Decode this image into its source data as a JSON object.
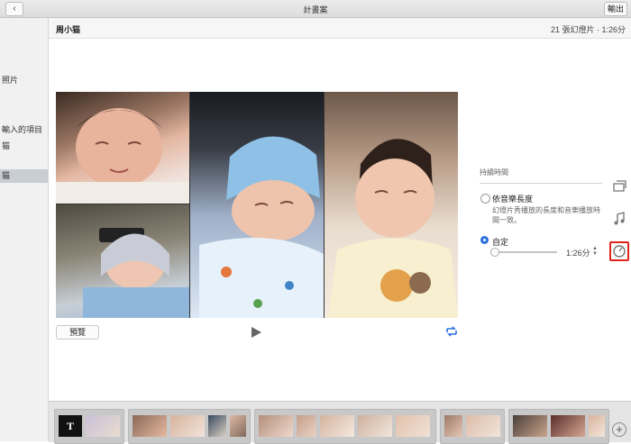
{
  "window": {
    "title": "計畫案",
    "back_glyph": "‹",
    "export_label": "輸出"
  },
  "sidebar": {
    "items": [
      "照片",
      "輸入的項目",
      "猫",
      "猫"
    ]
  },
  "project": {
    "name": "周小猫",
    "info": "21 張幻燈片 · 1:26分"
  },
  "player": {
    "preview_label": "預覽"
  },
  "settings": {
    "heading": "持續時間",
    "options": [
      {
        "label": "依音樂長度",
        "desc_line1": "幻燈片秀播放的長度和音樂播放時",
        "desc_line2": "間一致。",
        "selected": false
      },
      {
        "label": "自定",
        "selected": true
      }
    ],
    "duration": "1:26分",
    "slider_fraction": 0.03
  },
  "tools": [
    "layout-icon",
    "music-icon",
    "duration-icon"
  ],
  "filmstrip": {
    "title_thumb": "T",
    "add_glyph": "+"
  },
  "colors": {
    "accent": "#2a6fdb",
    "highlight": "#e0241c"
  }
}
